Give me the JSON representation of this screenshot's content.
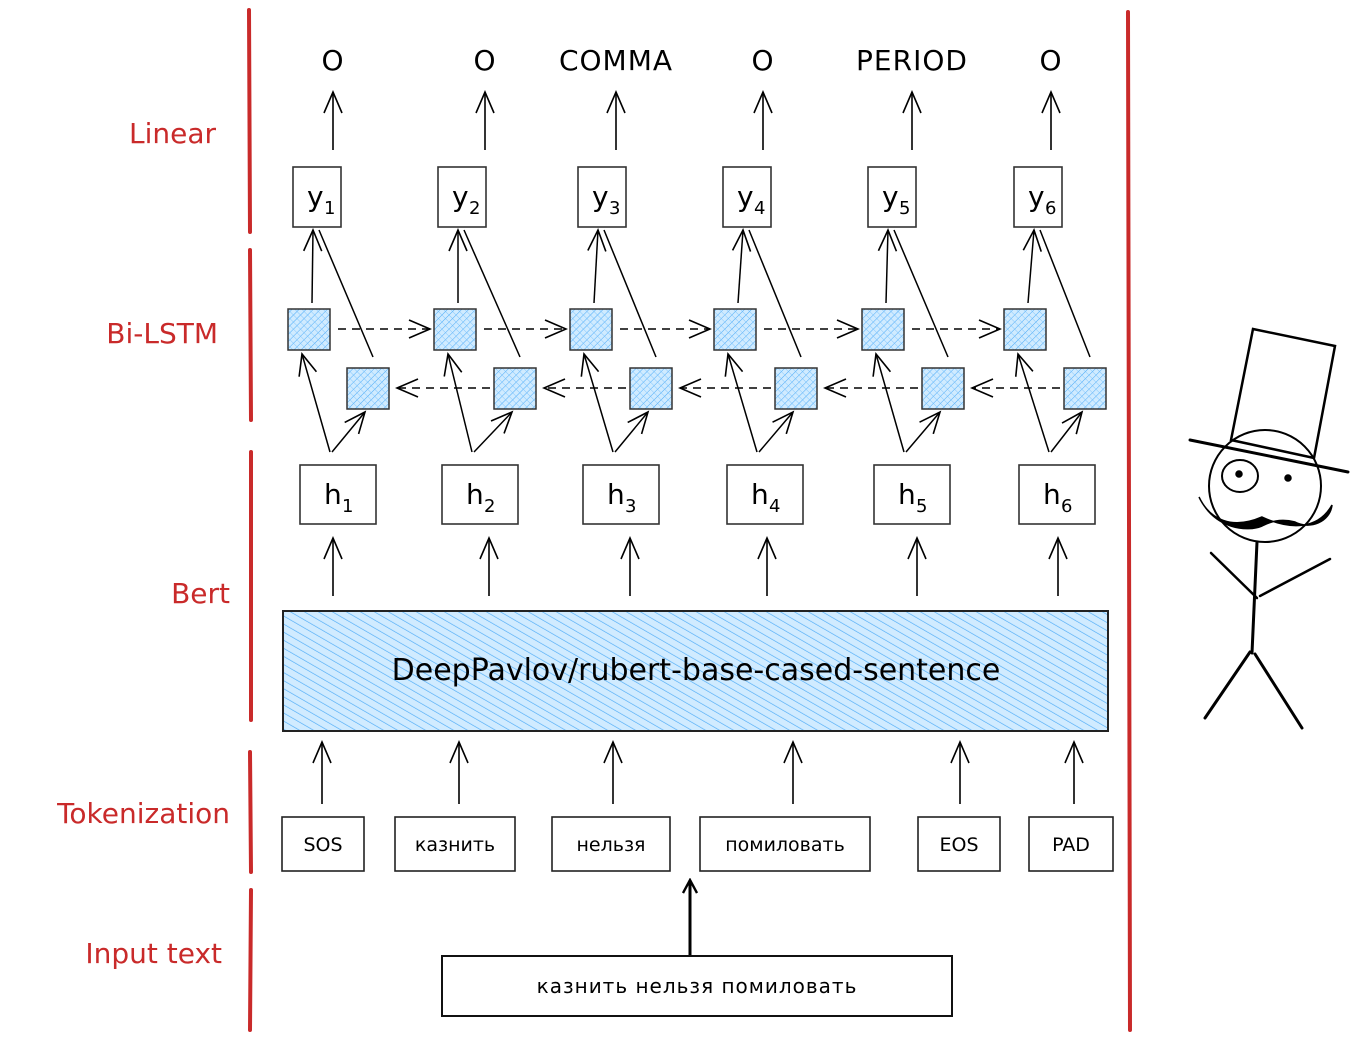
{
  "colors": {
    "layer_accent": "#c92a2a",
    "hatch_fill": "#a5d8ff",
    "hatch_stroke": "#4dabf7",
    "ink": "#000000"
  },
  "layers": [
    {
      "key": "linear",
      "label": "Linear"
    },
    {
      "key": "bilstm",
      "label": "Bi-LSTM"
    },
    {
      "key": "bert",
      "label": "Bert"
    },
    {
      "key": "tokenization",
      "label": "Tokenization"
    },
    {
      "key": "input",
      "label": "Input text"
    }
  ],
  "outputs": [
    "O",
    "O",
    "COMMA",
    "O",
    "PERIOD",
    "O"
  ],
  "y_nodes": [
    {
      "base": "y",
      "sub": "1"
    },
    {
      "base": "y",
      "sub": "2"
    },
    {
      "base": "y",
      "sub": "3"
    },
    {
      "base": "y",
      "sub": "4"
    },
    {
      "base": "y",
      "sub": "5"
    },
    {
      "base": "y",
      "sub": "6"
    }
  ],
  "h_nodes": [
    {
      "base": "h",
      "sub": "1"
    },
    {
      "base": "h",
      "sub": "2"
    },
    {
      "base": "h",
      "sub": "3"
    },
    {
      "base": "h",
      "sub": "4"
    },
    {
      "base": "h",
      "sub": "5"
    },
    {
      "base": "h",
      "sub": "6"
    }
  ],
  "bilstm": {
    "forward_cells": 6,
    "backward_cells": 6
  },
  "bert": {
    "model_name": "DeepPavlov/rubert-base-cased-sentence"
  },
  "tokens": [
    "SOS",
    "казнить",
    "нельзя",
    "помиловать",
    "EOS",
    "PAD"
  ],
  "input_text": "казнить нельзя помиловать",
  "mascot": {
    "description": "stick figure with top hat, monocle and mustache"
  }
}
